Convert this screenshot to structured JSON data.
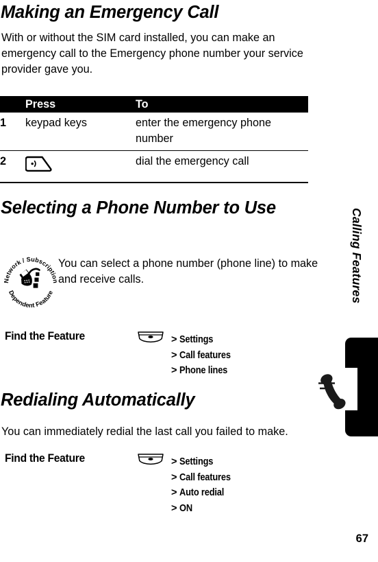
{
  "page": {
    "number": "67",
    "side_tab_title": "Calling Features"
  },
  "sections": [
    {
      "heading": "Making an Emergency Call",
      "body": "With or without the SIM card installed, you can make an emergency call to the Emergency phone number your service provider gave you."
    },
    {
      "heading": "Selecting a Phone Number to Use",
      "note": "You can select a phone number (phone line) to make and receive calls."
    },
    {
      "heading": "Redialing Automatically",
      "body": "You can immediately redial the last call you failed to make."
    }
  ],
  "table": {
    "headers": {
      "num": "",
      "press": "Press",
      "to": "To"
    },
    "rows": [
      {
        "num": "1",
        "press": "keypad keys",
        "press_icon": "",
        "to": "enter the emergency phone number"
      },
      {
        "num": "2",
        "press": "",
        "press_icon": "send-key-icon",
        "to": "dial the emergency call"
      }
    ]
  },
  "note_badge": {
    "top_arc": "Network / Subscription",
    "bottom_arc": "Dependent Feature",
    "icon": "phone-with-squares-icon"
  },
  "find_the_feature": [
    {
      "label": "Find the Feature",
      "menu_icon": "menu-key-icon",
      "path": [
        "Settings",
        "Call features",
        "Phone lines"
      ]
    },
    {
      "label": "Find the Feature",
      "menu_icon": "menu-key-icon",
      "path": [
        "Settings",
        "Call features",
        "Auto redial",
        "ON"
      ]
    }
  ],
  "colors": {
    "text": "#000000",
    "background": "#ffffff",
    "table_header_bg": "#000000",
    "table_header_text": "#ffffff",
    "side_tab": "#000000"
  },
  "separator": ">"
}
